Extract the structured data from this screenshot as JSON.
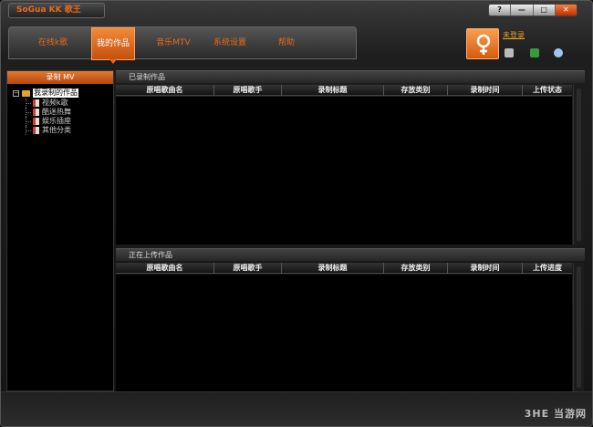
{
  "app": {
    "title": "SoGua KK 歌王"
  },
  "window_controls": [
    "?",
    "—",
    "□",
    "✕"
  ],
  "nav": {
    "items": [
      {
        "label": "在线k歌",
        "active": false
      },
      {
        "label": "我的作品",
        "active": true
      },
      {
        "label": "音乐MTV",
        "active": false
      },
      {
        "label": "系统设置",
        "active": false
      },
      {
        "label": "帮助",
        "active": false
      }
    ]
  },
  "user": {
    "login_label": "未登录",
    "avatar_icon": "female-symbol-icon"
  },
  "left_panel": {
    "header": "录制 MV",
    "tree_root": "我录制的作品",
    "tree_children": [
      "视频k歌",
      "酷迷热舞",
      "娱乐插座",
      "其他分类"
    ]
  },
  "recorded": {
    "title": "已录制作品",
    "columns": [
      "原唱歌曲名",
      "原唱歌手",
      "录制标题",
      "存放类别",
      "录制时间",
      "上传状态"
    ]
  },
  "uploading": {
    "title": "正在上传作品",
    "columns": [
      "原唱歌曲名",
      "原唱歌手",
      "录制标题",
      "存放类别",
      "录制时间",
      "上传进度"
    ]
  },
  "watermark": "3HE 当游网",
  "colors": {
    "accent": "#e86a1a",
    "background": "#000000"
  }
}
